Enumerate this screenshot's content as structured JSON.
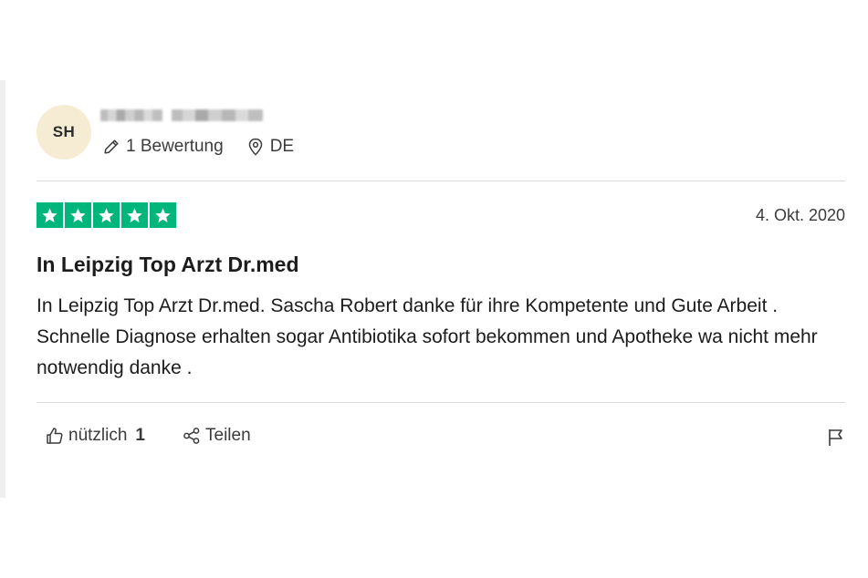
{
  "reviewer": {
    "initials": "SH",
    "name_redacted": true,
    "review_count": "1 Bewertung",
    "country": "DE"
  },
  "review": {
    "rating": 5,
    "max_rating": 5,
    "date": "4. Okt. 2020",
    "title": "In Leipzig Top Arzt Dr.med",
    "body_lines": [
      "In Leipzig Top Arzt Dr.med. Sascha Robert danke für ihre Kompetente und Gute Arbeit .",
      "Schnelle Diagnose erhalten sogar Antibiotika sofort bekommen und Apotheke wa nicht mehr notwendig danke ."
    ]
  },
  "actions": {
    "useful_label": "nützlich",
    "useful_count": "1",
    "share_label": "Teilen"
  },
  "icons": {
    "edit": "pencil-icon",
    "location": "location-pin-icon",
    "star": "star-icon",
    "useful": "thumbs-up-icon",
    "share": "share-icon",
    "report": "flag-icon"
  },
  "colors": {
    "star_background": "#00b67a",
    "avatar_background": "#f5ecd3"
  }
}
